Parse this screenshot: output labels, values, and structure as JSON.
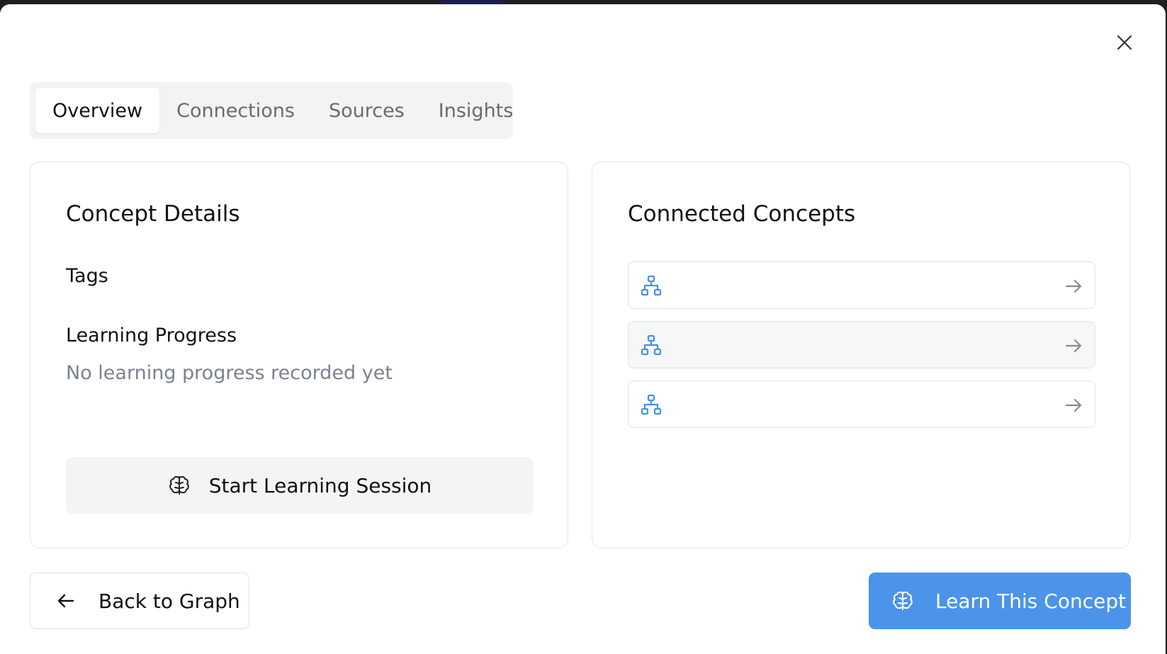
{
  "dialog": {
    "close_icon": "close-icon"
  },
  "tabs": [
    {
      "label": "Overview",
      "active": true
    },
    {
      "label": "Connections",
      "active": false
    },
    {
      "label": "Sources",
      "active": false
    },
    {
      "label": "Insights",
      "active": false
    }
  ],
  "details_card": {
    "title": "Concept Details",
    "tags_label": "Tags",
    "progress_label": "Learning Progress",
    "progress_empty": "No learning progress recorded yet",
    "session_button": "Start Learning Session",
    "session_icon": "brain-icon"
  },
  "connected_card": {
    "title": "Connected Concepts",
    "items": [
      {
        "icon": "network-icon",
        "label": "",
        "action_icon": "arrow-right-icon"
      },
      {
        "icon": "network-icon",
        "label": "",
        "action_icon": "arrow-right-icon"
      },
      {
        "icon": "network-icon",
        "label": "",
        "action_icon": "arrow-right-icon"
      }
    ]
  },
  "footer": {
    "back_label": "Back to Graph",
    "back_icon": "arrow-left-icon",
    "learn_label": "Learn This Concept",
    "learn_icon": "brain-icon"
  },
  "colors": {
    "accent": "#4c93ea",
    "muted_text": "#7b8190",
    "icon_blue": "#4a8ee6"
  }
}
